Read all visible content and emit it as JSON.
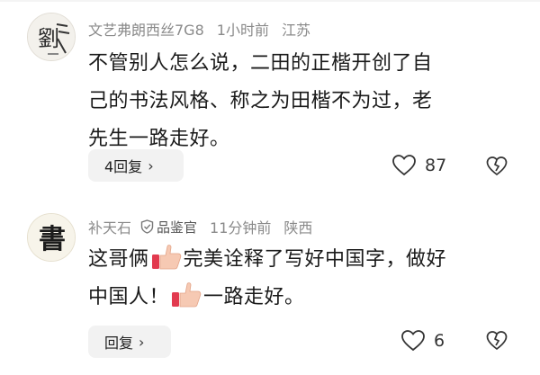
{
  "comments": [
    {
      "username": "文艺弗朗西丝7G8",
      "time": "1小时前",
      "location": "江苏",
      "text_lines": [
        "不管别人怎么说，二田的正楷开创了自",
        "己的书法风格、称之为田楷不为过，老",
        "先生一路走好。"
      ],
      "reply_label": "4回复",
      "like_count": "87"
    },
    {
      "username": "补天石",
      "badge": "品鉴官",
      "time": "11分钟前",
      "location": "陕西",
      "text_line1_a": "这哥俩",
      "text_line1_b": "完美诠释了写好中国字，做好",
      "text_line2_a": "中国人！",
      "text_line2_b": "一路走好。",
      "reply_label": "回复",
      "like_count": "6"
    }
  ],
  "icons": {
    "like": "heart-icon",
    "dislike": "broken-heart-icon",
    "thumb": "thumbs-up-emoji",
    "badge": "shield-check-icon",
    "chevron": "chevron-right-icon"
  },
  "avatar1_text": "劉",
  "avatar2_text": "書"
}
